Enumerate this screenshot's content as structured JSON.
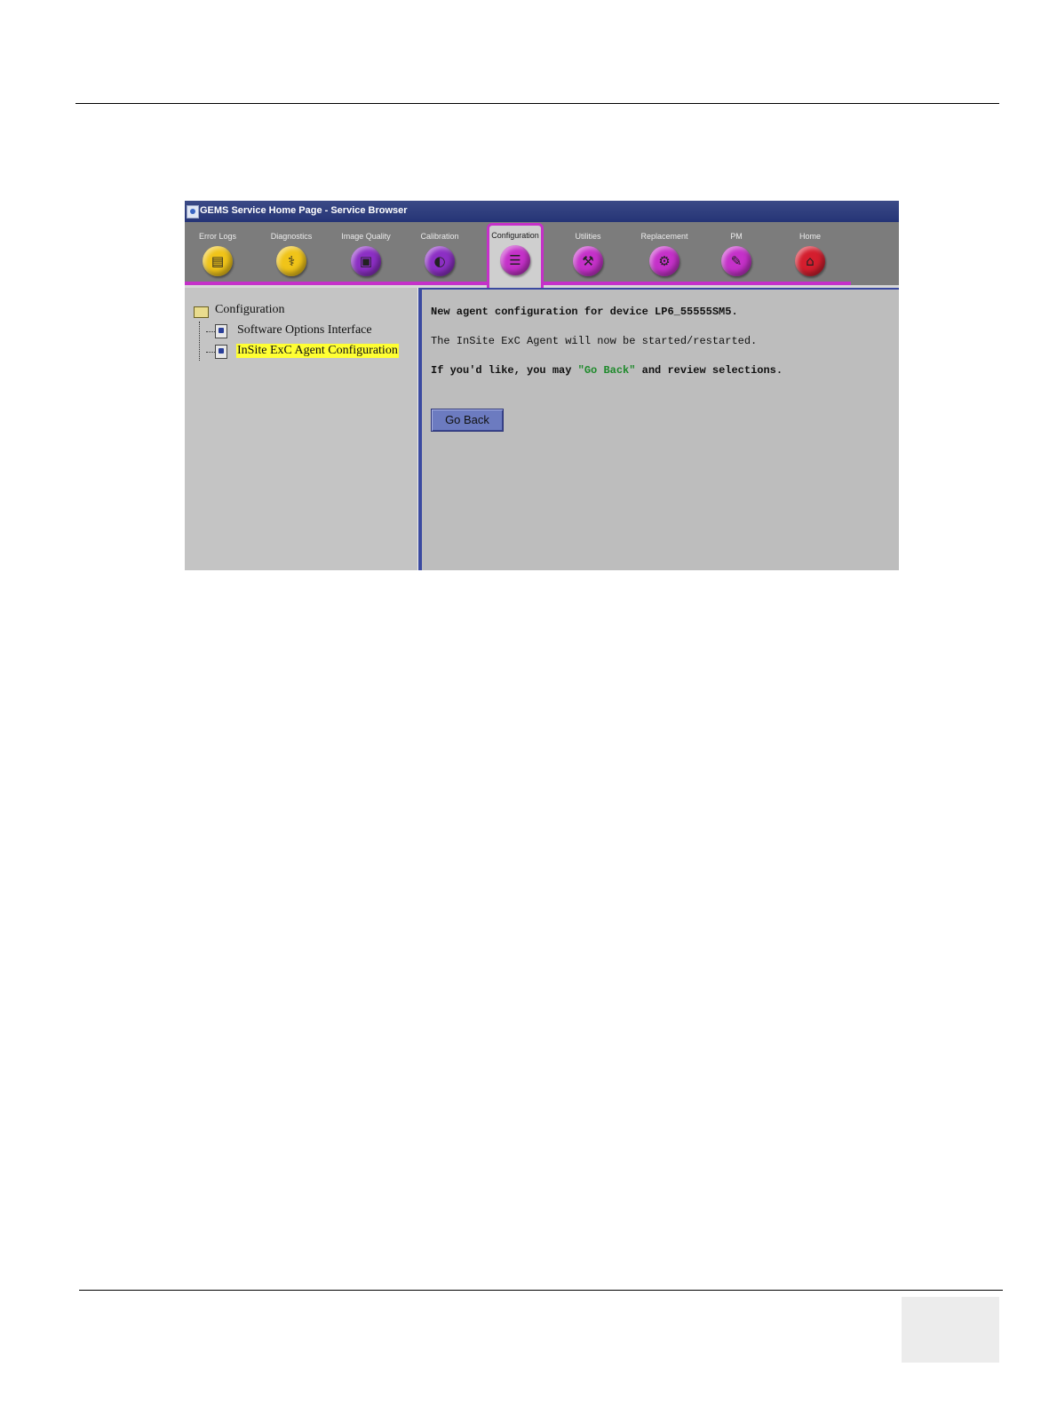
{
  "window": {
    "title": "GEMS Service Home Page - Service Browser"
  },
  "toolbar": {
    "tabs": [
      {
        "label": "Error Logs",
        "icon": "error-logs-icon",
        "color": "#f0c419",
        "glyph": "▤"
      },
      {
        "label": "Diagnostics",
        "icon": "stethoscope-icon",
        "color": "#f0c419",
        "glyph": "⚕"
      },
      {
        "label": "Image Quality",
        "icon": "image-quality-icon",
        "color": "#8c2fc4",
        "glyph": "▣"
      },
      {
        "label": "Calibration",
        "icon": "calibration-icon",
        "color": "#8c2fc4",
        "glyph": "◐"
      },
      {
        "label": "Configuration",
        "icon": "configuration-icon",
        "color": "#c531c9",
        "glyph": "☰",
        "active": true
      },
      {
        "label": "Utilities",
        "icon": "utilities-icon",
        "color": "#c531c9",
        "glyph": "⚒"
      },
      {
        "label": "Replacement",
        "icon": "replacement-icon",
        "color": "#c531c9",
        "glyph": "⚙"
      },
      {
        "label": "PM",
        "icon": "pm-icon",
        "color": "#c531c9",
        "glyph": "✎"
      },
      {
        "label": "Home",
        "icon": "home-icon",
        "color": "#d41e2e",
        "glyph": "⌂"
      }
    ]
  },
  "tree": {
    "root": "Configuration",
    "children": [
      {
        "label": "Software Options Interface"
      },
      {
        "label": "InSite ExC Agent Configuration",
        "selected": true
      }
    ]
  },
  "main": {
    "line1": "New agent configuration for device LP6_55555SM5.",
    "line2": "The InSite ExC Agent will now be started/restarted.",
    "line3_prefix": "If you'd like, you may ",
    "line3_link": "\"Go Back\"",
    "line3_suffix": " and review selections.",
    "go_back_label": "Go Back"
  }
}
